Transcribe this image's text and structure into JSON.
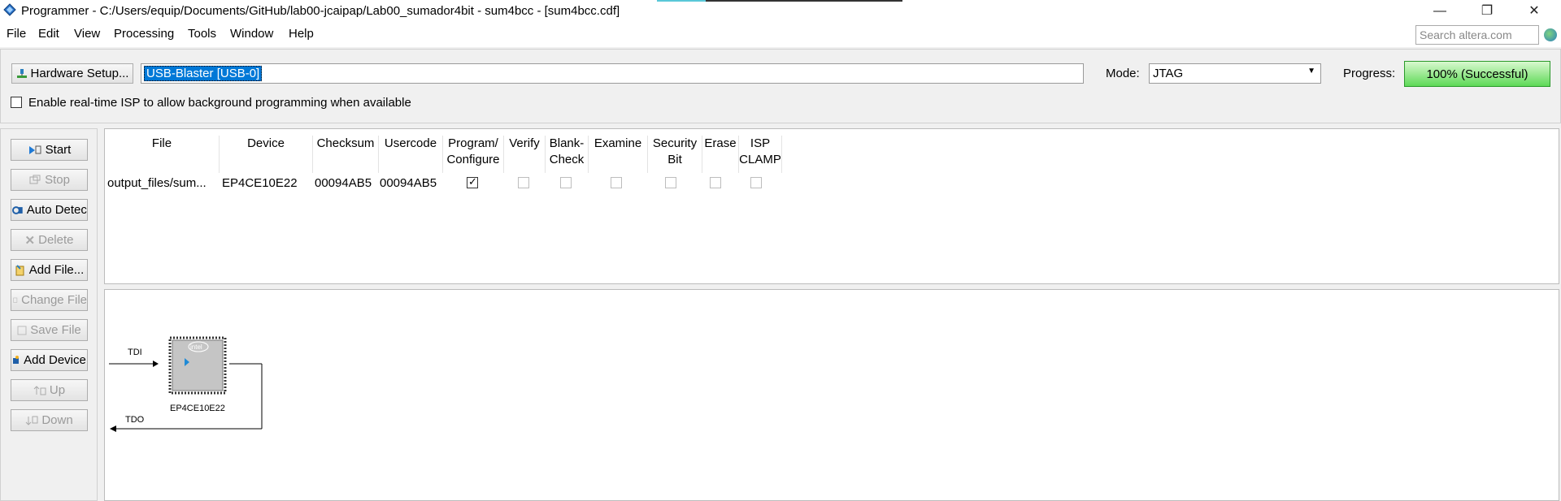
{
  "window": {
    "title": "Programmer - C:/Users/equip/Documents/GitHub/lab00-jcaipap/Lab00_sumador4bit - sum4bcc - [sum4bcc.cdf]",
    "minimize": "—",
    "maximize": "❐",
    "close": "✕"
  },
  "menu": {
    "file": "File",
    "edit": "Edit",
    "view": "View",
    "processing": "Processing",
    "tools": "Tools",
    "window": "Window",
    "help": "Help",
    "search_placeholder": "Search altera.com"
  },
  "toolbar": {
    "hardware_setup": "Hardware Setup...",
    "hardware_value": "USB-Blaster [USB-0]",
    "mode_label": "Mode:",
    "mode_value": "JTAG",
    "progress_label": "Progress:",
    "progress_text": "100% (Successful)",
    "progress_fraction": 1.0,
    "isp_label": "Enable real-time ISP to allow background programming when available",
    "isp_checked": false
  },
  "side_buttons": [
    {
      "label": "Start",
      "enabled": true,
      "icon": "start-icon"
    },
    {
      "label": "Stop",
      "enabled": false,
      "icon": "stop-icon"
    },
    {
      "label": "Auto Detect",
      "enabled": true,
      "icon": "auto-detect-icon"
    },
    {
      "label": "Delete",
      "enabled": false,
      "icon": "delete-icon"
    },
    {
      "label": "Add File...",
      "enabled": true,
      "icon": "add-file-icon"
    },
    {
      "label": "Change File",
      "enabled": false,
      "icon": "change-file-icon"
    },
    {
      "label": "Save File",
      "enabled": false,
      "icon": "save-file-icon"
    },
    {
      "label": "Add Device",
      "enabled": true,
      "icon": "add-device-icon"
    },
    {
      "label": "Up",
      "enabled": false,
      "icon": "up-icon"
    },
    {
      "label": "Down",
      "enabled": false,
      "icon": "down-icon"
    }
  ],
  "table": {
    "headers": {
      "file": "File",
      "device": "Device",
      "checksum": "Checksum",
      "usercode": "Usercode",
      "program_1": "Program/",
      "program_2": "Configure",
      "verify": "Verify",
      "blank_1": "Blank-",
      "blank_2": "Check",
      "examine": "Examine",
      "security_1": "Security",
      "security_2": "Bit",
      "erase": "Erase",
      "isp_1": "ISP",
      "isp_2": "CLAMP"
    },
    "rows": [
      {
        "file": "output_files/sum...",
        "device": "EP4CE10E22",
        "checksum": "00094AB5",
        "usercode": "00094AB5",
        "program": true,
        "verify": false,
        "blank_check": false,
        "examine": false,
        "security_bit": false,
        "erase": false,
        "isp_clamp": false
      }
    ]
  },
  "chain": {
    "tdi": "TDI",
    "tdo": "TDO",
    "device": "EP4CE10E22",
    "chip_logo": "intel"
  },
  "colors": {
    "selection": "#0078d7",
    "progress_green": "#5ed957"
  }
}
